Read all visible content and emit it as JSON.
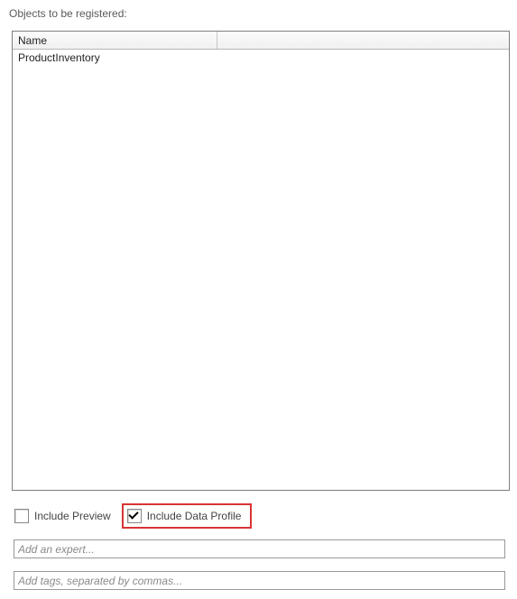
{
  "title": "Objects to be registered:",
  "table": {
    "columns": [
      "Name"
    ],
    "rows": [
      {
        "name": "ProductInventory"
      }
    ]
  },
  "options": {
    "include_preview": {
      "label": "Include Preview",
      "checked": false
    },
    "include_data_profile": {
      "label": "Include Data Profile",
      "checked": true
    }
  },
  "inputs": {
    "expert_placeholder": "Add an expert...",
    "tags_placeholder": "Add tags, separated by commas..."
  }
}
